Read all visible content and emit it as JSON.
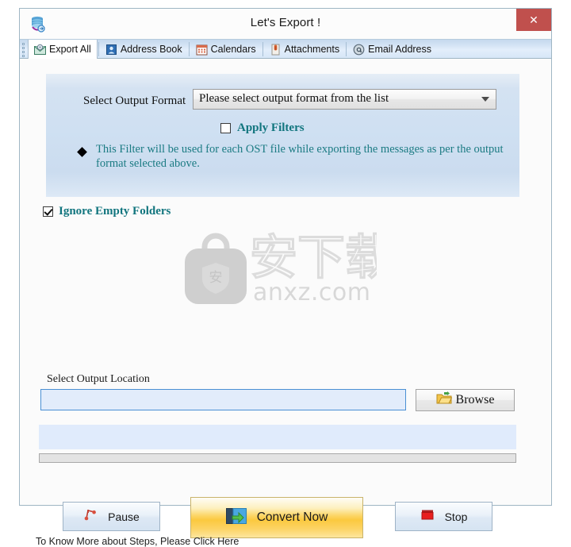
{
  "window": {
    "title": "Let's Export !",
    "app_icon": "database-export-icon",
    "close_label": "✕"
  },
  "tabs": [
    {
      "label": "Export All",
      "icon": "envelope-icon",
      "active": true
    },
    {
      "label": "Address Book",
      "icon": "contact-card-icon",
      "active": false
    },
    {
      "label": "Calendars",
      "icon": "calendar-icon",
      "active": false
    },
    {
      "label": "Attachments",
      "icon": "paperclip-icon",
      "active": false
    },
    {
      "label": "Email Address",
      "icon": "at-sign-icon",
      "active": false
    }
  ],
  "filter_panel": {
    "format_label": "Select Output Format",
    "format_selected": "Please select output format from the list",
    "format_placeholder": "Please select output format from the list",
    "apply_filters_label": "Apply Filters",
    "apply_filters_checked": false,
    "note": "This Filter will be used for each OST file while exporting the messages as per the output format selected above."
  },
  "options": {
    "ignore_empty_folders_label": "Ignore Empty Folders",
    "ignore_empty_folders_checked": true
  },
  "watermark": {
    "chinese_text": "安下载",
    "shield_char": "安",
    "url": "anxz.com"
  },
  "output": {
    "location_label": "Select Output Location",
    "location_value": "",
    "location_placeholder": "",
    "browse_label": "Browse",
    "browse_icon": "open-folder-icon"
  },
  "progress": {
    "status_text": "",
    "percent": 0
  },
  "actions": {
    "pause_label": "Pause",
    "pause_icon": "pause-icon",
    "convert_label": "Convert Now",
    "convert_icon": "export-arrow-icon",
    "stop_label": "Stop",
    "stop_icon": "stop-square-icon"
  },
  "footer": {
    "link_text": "To Know More about Steps, Please Click Here"
  },
  "colors": {
    "accent_teal": "#11757e",
    "close_red": "#c0504d",
    "convert_amber": "#fbc93f",
    "panel_blue": "#cfe0f2",
    "input_blue": "#e2ecfb"
  }
}
